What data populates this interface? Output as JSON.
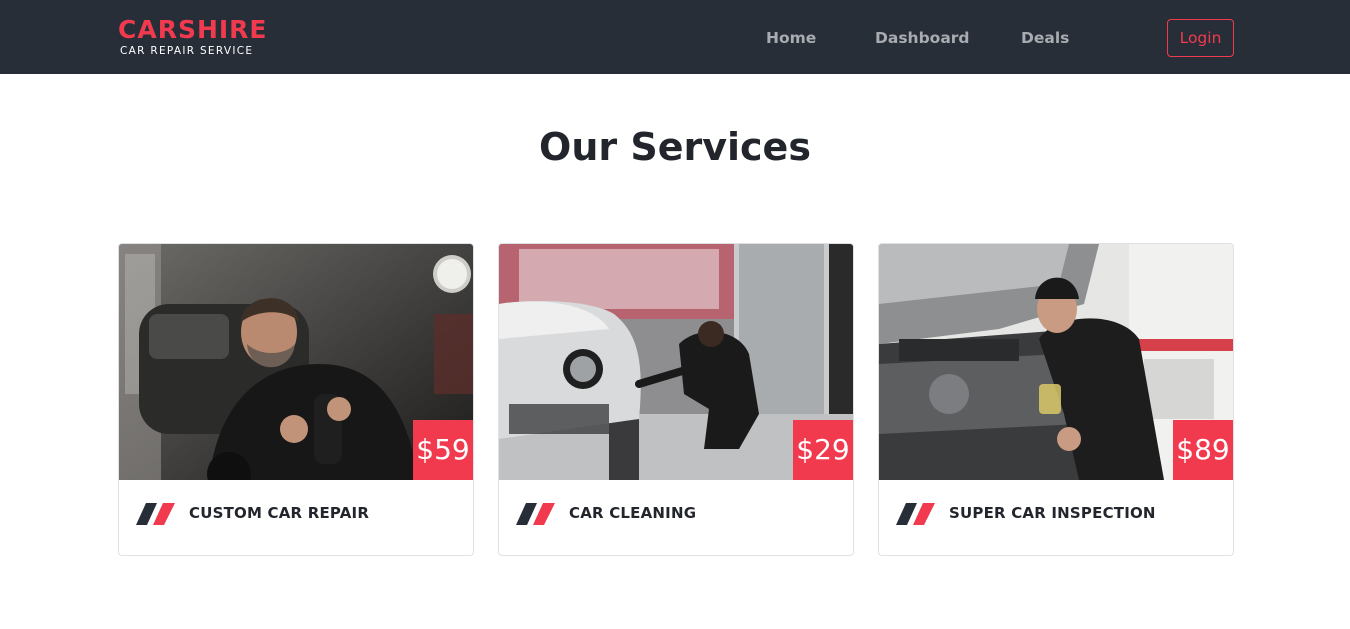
{
  "header": {
    "brand_name": "CARSHIRE",
    "brand_tagline": "CAR REPAIR SERVICE",
    "nav": {
      "home": "Home",
      "dashboard": "Dashboard",
      "deals": "Deals"
    },
    "login_label": "Login"
  },
  "main": {
    "title": "Our Services",
    "services": [
      {
        "title": "CUSTOM CAR REPAIR",
        "price": "$59"
      },
      {
        "title": "CAR CLEANING",
        "price": "$29"
      },
      {
        "title": "SUPER CAR INSPECTION",
        "price": "$89"
      }
    ]
  },
  "colors": {
    "accent": "#f23a4e",
    "navbar_bg": "#282e38",
    "text_dark": "#22262c",
    "nav_link": "#a8acb1"
  },
  "icons": {
    "card_mark": "double-slash-icon"
  }
}
